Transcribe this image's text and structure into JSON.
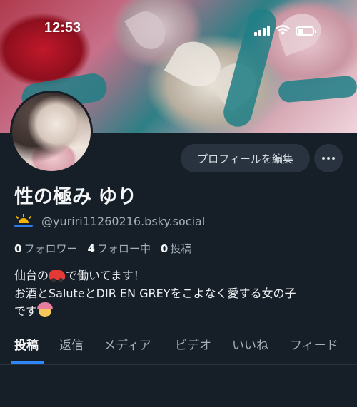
{
  "status_bar": {
    "time": "12:53",
    "battery_level": 0.4
  },
  "profile": {
    "display_name": "性の極み ゆり",
    "handle": "@yuriri11260216.bsky.social",
    "edit_profile_label": "プロフィールを編集",
    "stats": [
      {
        "value": "0",
        "label": "フォロワー"
      },
      {
        "value": "4",
        "label": "フォロー中"
      },
      {
        "value": "0",
        "label": "投稿"
      }
    ],
    "bio": {
      "line1_before": "仙台の",
      "line1_after": "で働いてます！",
      "line2": "お酒とSaluteとDIR EN GREYをこよなく愛する女の子",
      "line3": "です"
    }
  },
  "tabs": [
    {
      "label": "投稿"
    },
    {
      "label": "返信"
    },
    {
      "label": "メディア"
    },
    {
      "label": "ビデオ"
    },
    {
      "label": "いいね"
    },
    {
      "label": "フィード"
    }
  ],
  "icons": {
    "handle_prefix": "sunrise-icon",
    "bio_car": "red-car-emoji",
    "bio_end": "person-raising-hand-emoji",
    "more": "ellipsis-icon"
  },
  "colors": {
    "background": "#161e27",
    "button_bg": "#28333f",
    "accent": "#2f86f6",
    "muted_text": "#a4afba"
  }
}
